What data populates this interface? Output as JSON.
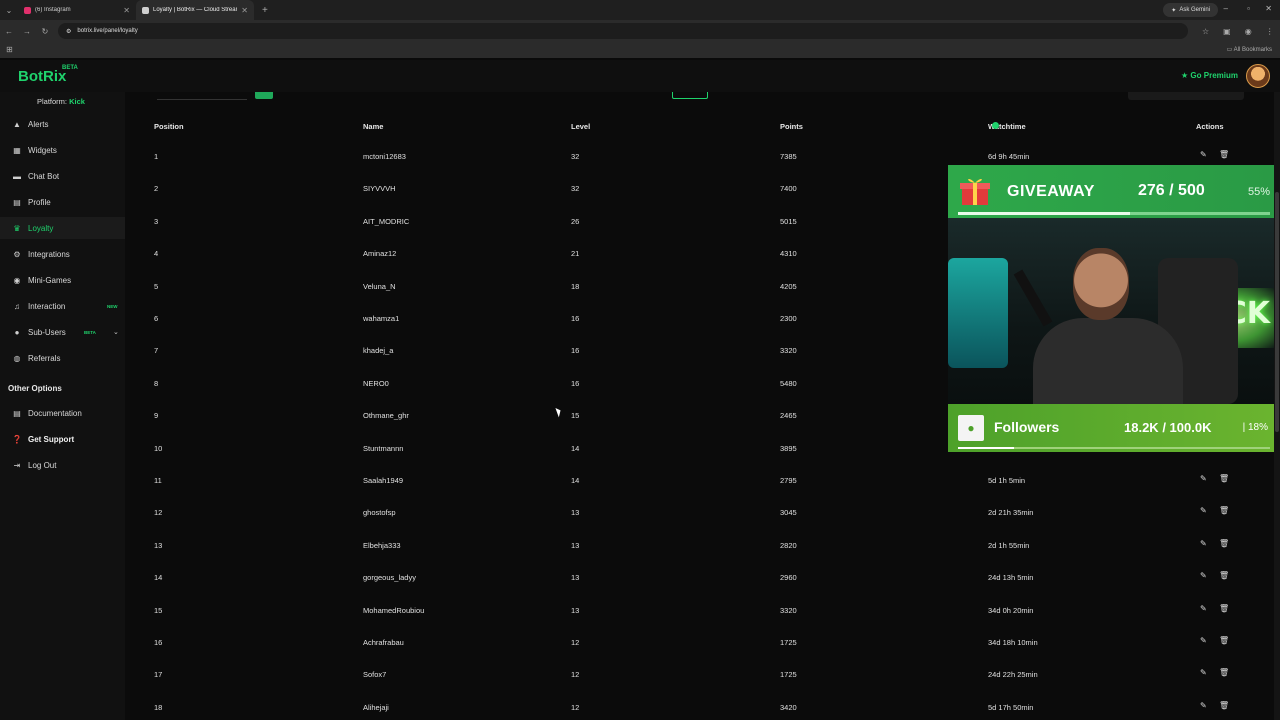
{
  "browser": {
    "tabs": [
      {
        "title": "(6) Instagram",
        "fav_color": "#e1306c"
      },
      {
        "title": "Loyalty | BotRix — Cloud Stream",
        "fav_color": "#cfcfcf"
      }
    ],
    "url": "botrix.live/panel/loyalty",
    "ask_gemini": "Ask Gemini",
    "all_bookmarks": "All Bookmarks"
  },
  "app": {
    "logo": "BotRix",
    "beta": "BETA",
    "go_premium": "Go Premium"
  },
  "sidebar": {
    "platform_label": "Platform:",
    "platform_value": "Kick",
    "items": [
      {
        "label": "Alerts",
        "icon": "bell-icon"
      },
      {
        "label": "Widgets",
        "icon": "grid-icon"
      },
      {
        "label": "Chat Bot",
        "icon": "chat-icon"
      },
      {
        "label": "Profile",
        "icon": "id-card-icon"
      },
      {
        "label": "Loyalty",
        "icon": "trophy-icon"
      },
      {
        "label": "Integrations",
        "icon": "plug-icon"
      },
      {
        "label": "Mini-Games",
        "icon": "gamepad-icon"
      },
      {
        "label": "Interaction",
        "icon": "music-icon",
        "badge": "NEW"
      },
      {
        "label": "Sub-Users",
        "icon": "users-icon",
        "badge": "BETA"
      },
      {
        "label": "Referrals",
        "icon": "referral-icon"
      }
    ],
    "other_heading": "Other Options",
    "other_items": [
      {
        "label": "Documentation",
        "icon": "document-icon"
      },
      {
        "label": "Get Support",
        "icon": "help-icon"
      },
      {
        "label": "Log Out",
        "icon": "logout-icon"
      }
    ]
  },
  "table": {
    "headers": {
      "position": "Position",
      "name": "Name",
      "level": "Level",
      "points": "Points",
      "watchtime": "Watchtime",
      "actions": "Actions"
    },
    "rows": [
      {
        "position": "1",
        "name": "mctoni12683",
        "level": "32",
        "points": "7385",
        "watchtime": "6d 9h 45min"
      },
      {
        "position": "2",
        "name": "SIYVVVH",
        "level": "32",
        "points": "7400",
        "watchtime": ""
      },
      {
        "position": "3",
        "name": "AIT_MODRIC",
        "level": "26",
        "points": "5015",
        "watchtime": ""
      },
      {
        "position": "4",
        "name": "Aminaz12",
        "level": "21",
        "points": "4310",
        "watchtime": ""
      },
      {
        "position": "5",
        "name": "Veluna_N",
        "level": "18",
        "points": "4205",
        "watchtime": ""
      },
      {
        "position": "6",
        "name": "wahamza1",
        "level": "16",
        "points": "2300",
        "watchtime": ""
      },
      {
        "position": "7",
        "name": "khadej_a",
        "level": "16",
        "points": "3320",
        "watchtime": ""
      },
      {
        "position": "8",
        "name": "NERO0",
        "level": "16",
        "points": "5480",
        "watchtime": ""
      },
      {
        "position": "9",
        "name": "Othmane_ghr",
        "level": "15",
        "points": "2465",
        "watchtime": ""
      },
      {
        "position": "10",
        "name": "Stuntmannn",
        "level": "14",
        "points": "3895",
        "watchtime": ""
      },
      {
        "position": "11",
        "name": "Saalah1949",
        "level": "14",
        "points": "2795",
        "watchtime": "5d 1h 5min"
      },
      {
        "position": "12",
        "name": "ghostofsp",
        "level": "13",
        "points": "3045",
        "watchtime": "2d 21h 35min"
      },
      {
        "position": "13",
        "name": "Elbehja333",
        "level": "13",
        "points": "2820",
        "watchtime": "2d 1h 55min"
      },
      {
        "position": "14",
        "name": "gorgeous_ladyy",
        "level": "13",
        "points": "2960",
        "watchtime": "24d 13h 5min"
      },
      {
        "position": "15",
        "name": "MohamedRoubiou",
        "level": "13",
        "points": "3320",
        "watchtime": "34d 0h 20min"
      },
      {
        "position": "16",
        "name": "Achrafrabau",
        "level": "12",
        "points": "1725",
        "watchtime": "34d 18h 10min"
      },
      {
        "position": "17",
        "name": "Sofox7",
        "level": "12",
        "points": "1725",
        "watchtime": "24d 22h 25min"
      },
      {
        "position": "18",
        "name": "Alihejaji",
        "level": "12",
        "points": "3420",
        "watchtime": "5d 17h 50min"
      }
    ]
  },
  "overlay": {
    "giveaway": {
      "title": "GIVEAWAY",
      "current": "276",
      "target": "500",
      "percent": "55%",
      "progress": 0.55
    },
    "followers": {
      "title": "Followers",
      "current": "18.2K",
      "target": "100.0K",
      "percent": "18%",
      "progress": 0.18
    },
    "webcam_sign": "KICK"
  }
}
